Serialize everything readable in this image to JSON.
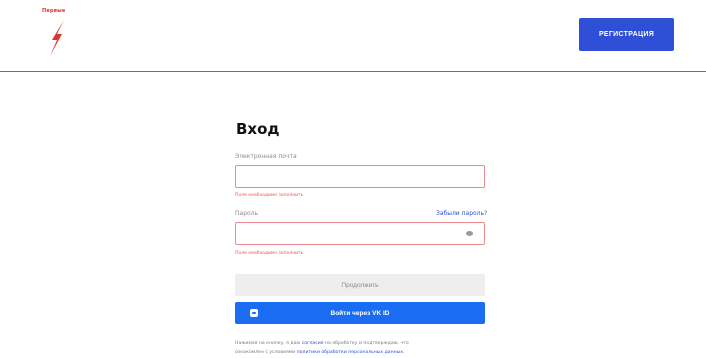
{
  "header": {
    "logo_text": "Первые",
    "register_label": "РЕГИСТРАЦИЯ"
  },
  "form": {
    "title": "Вход",
    "email_label": "Электронная почта",
    "email_value": "",
    "email_error": "Поле необходимо заполнить",
    "password_label": "Пароль",
    "password_value": "",
    "forgot_label": "Забыли пароль?",
    "password_error": "Поле необходимо заполнить",
    "continue_label": "Продолжить",
    "vk_label": "Войти через VK ID"
  },
  "consent": {
    "line1_pre": "Нажимая на кнопку, я даю ",
    "line1_link": "согласие",
    "line1_post": " на обработку и подтверждаю, что",
    "line2_pre": "ознакомлен с условиями ",
    "line2_link": "политики обработки персональных данных",
    "line2_post": "."
  },
  "colors": {
    "accent": "#2f4fd6",
    "vk": "#1a6cf2",
    "error": "#e0555e",
    "logo": "#e0322f"
  }
}
